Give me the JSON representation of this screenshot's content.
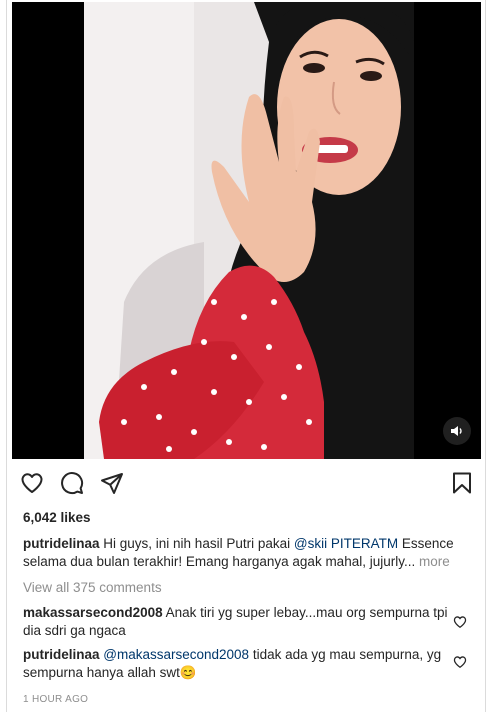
{
  "post": {
    "likes": "6,042 likes",
    "caption": {
      "username": "putridelinaa",
      "text_before": " Hi guys, ini nih hasil Putri pakai ",
      "mention": "@skii PITERATM",
      "text_after": " Essence selama dua bulan terakhir! Emang harganya agak mahal, jujurly... ",
      "more": "more"
    },
    "view_all_comments": "View all 375 comments",
    "comments": [
      {
        "username": "makassarsecond2008",
        "mention": "",
        "text": " Anak tiri yg super lebay...mau org sempurna tpi dia sdri ga ngaca"
      },
      {
        "username": "putridelinaa",
        "mention": "@makassarsecond2008",
        "text": " tidak ada yg mau sempurna, yg sempurna hanya allah swt😊"
      }
    ],
    "timestamp": "1 HOUR AGO"
  },
  "icons": {
    "like": "heart-icon",
    "comment": "comment-bubble-icon",
    "share": "paper-plane-icon",
    "save": "bookmark-icon",
    "sound": "speaker-icon",
    "comment_like": "small-heart-icon"
  },
  "colors": {
    "text": "#262626",
    "secondary": "#8e8e8e",
    "link": "#00376b",
    "media_bg": "#000000"
  }
}
